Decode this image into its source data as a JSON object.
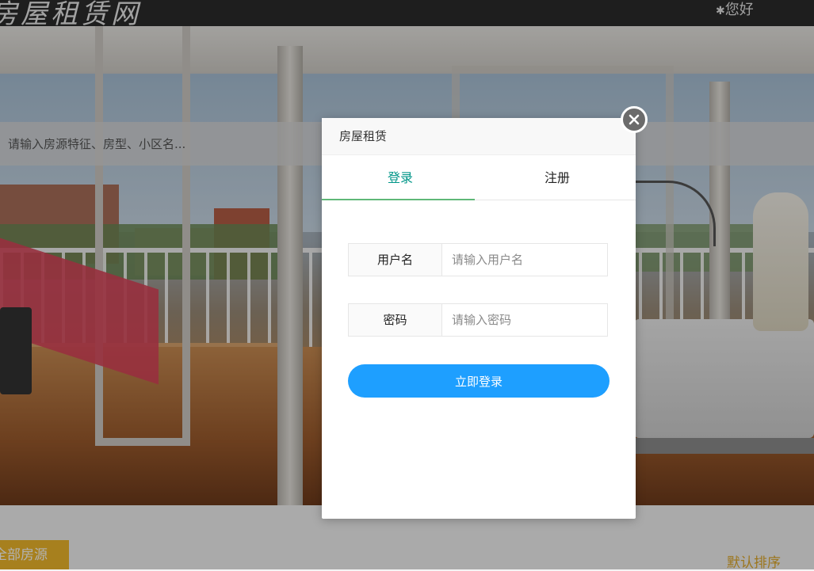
{
  "header": {
    "logo_text": "房屋租赁网",
    "greeting": "您好",
    "greeting_icon": "asterisk-icon"
  },
  "search": {
    "placeholder": "请输入房源特征、房型、小区名..."
  },
  "bottom": {
    "all_houses_label": "全部房源",
    "default_sort_label": "默认排序"
  },
  "modal": {
    "title": "房屋租赁",
    "close_icon": "close-icon",
    "tabs": [
      {
        "label": "登录",
        "active": true
      },
      {
        "label": "注册",
        "active": false
      }
    ],
    "username": {
      "label": "用户名",
      "placeholder": "请输入用户名",
      "value": ""
    },
    "password": {
      "label": "密码",
      "placeholder": "请输入密码",
      "value": ""
    },
    "submit_label": "立即登录"
  },
  "colors": {
    "accent_tab": "#009688",
    "tab_underline": "#5fb878",
    "primary_button": "#1e9fff",
    "close_button": "#6b6b6b",
    "highlight_yellow": "#f0b82c"
  }
}
